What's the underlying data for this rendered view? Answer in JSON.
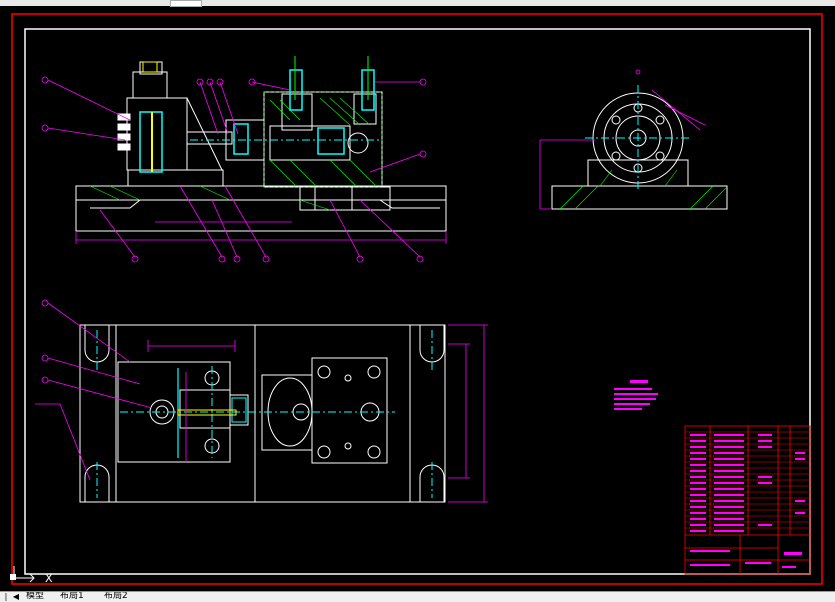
{
  "colors": {
    "background": "#000000",
    "frame": "#ff0000",
    "border": "#ffffff",
    "leader": "#ff00ff",
    "dimension": "#ff00ff",
    "centerline": "#00ffff",
    "hatch": "#00ff00",
    "cyan": "#00ffff",
    "yellow": "#ffff00"
  },
  "ucs": {
    "icon": "ucs-axis-icon",
    "x_label": "X"
  },
  "tabs": [
    {
      "label": "模型",
      "active": true
    },
    {
      "label": "布局1",
      "active": false
    },
    {
      "label": "布局2",
      "active": false
    }
  ],
  "tab_nav": {
    "first": "|◀",
    "prev": "◀",
    "next": "▶",
    "last": "▶|"
  }
}
